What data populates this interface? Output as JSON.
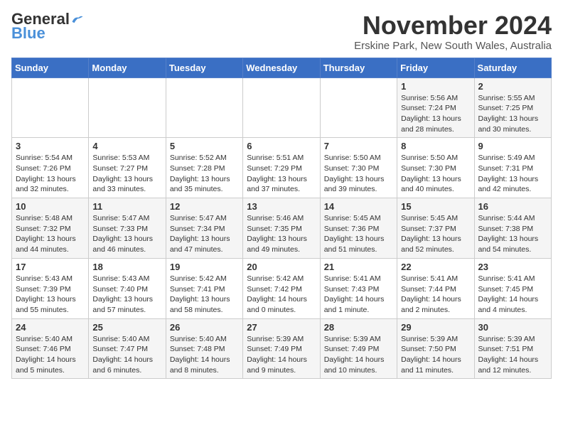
{
  "header": {
    "logo_general": "General",
    "logo_blue": "Blue",
    "title": "November 2024",
    "location": "Erskine Park, New South Wales, Australia"
  },
  "weekdays": [
    "Sunday",
    "Monday",
    "Tuesday",
    "Wednesday",
    "Thursday",
    "Friday",
    "Saturday"
  ],
  "weeks": [
    [
      {
        "day": "",
        "info": ""
      },
      {
        "day": "",
        "info": ""
      },
      {
        "day": "",
        "info": ""
      },
      {
        "day": "",
        "info": ""
      },
      {
        "day": "",
        "info": ""
      },
      {
        "day": "1",
        "info": "Sunrise: 5:56 AM\nSunset: 7:24 PM\nDaylight: 13 hours\nand 28 minutes."
      },
      {
        "day": "2",
        "info": "Sunrise: 5:55 AM\nSunset: 7:25 PM\nDaylight: 13 hours\nand 30 minutes."
      }
    ],
    [
      {
        "day": "3",
        "info": "Sunrise: 5:54 AM\nSunset: 7:26 PM\nDaylight: 13 hours\nand 32 minutes."
      },
      {
        "day": "4",
        "info": "Sunrise: 5:53 AM\nSunset: 7:27 PM\nDaylight: 13 hours\nand 33 minutes."
      },
      {
        "day": "5",
        "info": "Sunrise: 5:52 AM\nSunset: 7:28 PM\nDaylight: 13 hours\nand 35 minutes."
      },
      {
        "day": "6",
        "info": "Sunrise: 5:51 AM\nSunset: 7:29 PM\nDaylight: 13 hours\nand 37 minutes."
      },
      {
        "day": "7",
        "info": "Sunrise: 5:50 AM\nSunset: 7:30 PM\nDaylight: 13 hours\nand 39 minutes."
      },
      {
        "day": "8",
        "info": "Sunrise: 5:50 AM\nSunset: 7:30 PM\nDaylight: 13 hours\nand 40 minutes."
      },
      {
        "day": "9",
        "info": "Sunrise: 5:49 AM\nSunset: 7:31 PM\nDaylight: 13 hours\nand 42 minutes."
      }
    ],
    [
      {
        "day": "10",
        "info": "Sunrise: 5:48 AM\nSunset: 7:32 PM\nDaylight: 13 hours\nand 44 minutes."
      },
      {
        "day": "11",
        "info": "Sunrise: 5:47 AM\nSunset: 7:33 PM\nDaylight: 13 hours\nand 46 minutes."
      },
      {
        "day": "12",
        "info": "Sunrise: 5:47 AM\nSunset: 7:34 PM\nDaylight: 13 hours\nand 47 minutes."
      },
      {
        "day": "13",
        "info": "Sunrise: 5:46 AM\nSunset: 7:35 PM\nDaylight: 13 hours\nand 49 minutes."
      },
      {
        "day": "14",
        "info": "Sunrise: 5:45 AM\nSunset: 7:36 PM\nDaylight: 13 hours\nand 51 minutes."
      },
      {
        "day": "15",
        "info": "Sunrise: 5:45 AM\nSunset: 7:37 PM\nDaylight: 13 hours\nand 52 minutes."
      },
      {
        "day": "16",
        "info": "Sunrise: 5:44 AM\nSunset: 7:38 PM\nDaylight: 13 hours\nand 54 minutes."
      }
    ],
    [
      {
        "day": "17",
        "info": "Sunrise: 5:43 AM\nSunset: 7:39 PM\nDaylight: 13 hours\nand 55 minutes."
      },
      {
        "day": "18",
        "info": "Sunrise: 5:43 AM\nSunset: 7:40 PM\nDaylight: 13 hours\nand 57 minutes."
      },
      {
        "day": "19",
        "info": "Sunrise: 5:42 AM\nSunset: 7:41 PM\nDaylight: 13 hours\nand 58 minutes."
      },
      {
        "day": "20",
        "info": "Sunrise: 5:42 AM\nSunset: 7:42 PM\nDaylight: 14 hours\nand 0 minutes."
      },
      {
        "day": "21",
        "info": "Sunrise: 5:41 AM\nSunset: 7:43 PM\nDaylight: 14 hours\nand 1 minute."
      },
      {
        "day": "22",
        "info": "Sunrise: 5:41 AM\nSunset: 7:44 PM\nDaylight: 14 hours\nand 2 minutes."
      },
      {
        "day": "23",
        "info": "Sunrise: 5:41 AM\nSunset: 7:45 PM\nDaylight: 14 hours\nand 4 minutes."
      }
    ],
    [
      {
        "day": "24",
        "info": "Sunrise: 5:40 AM\nSunset: 7:46 PM\nDaylight: 14 hours\nand 5 minutes."
      },
      {
        "day": "25",
        "info": "Sunrise: 5:40 AM\nSunset: 7:47 PM\nDaylight: 14 hours\nand 6 minutes."
      },
      {
        "day": "26",
        "info": "Sunrise: 5:40 AM\nSunset: 7:48 PM\nDaylight: 14 hours\nand 8 minutes."
      },
      {
        "day": "27",
        "info": "Sunrise: 5:39 AM\nSunset: 7:49 PM\nDaylight: 14 hours\nand 9 minutes."
      },
      {
        "day": "28",
        "info": "Sunrise: 5:39 AM\nSunset: 7:49 PM\nDaylight: 14 hours\nand 10 minutes."
      },
      {
        "day": "29",
        "info": "Sunrise: 5:39 AM\nSunset: 7:50 PM\nDaylight: 14 hours\nand 11 minutes."
      },
      {
        "day": "30",
        "info": "Sunrise: 5:39 AM\nSunset: 7:51 PM\nDaylight: 14 hours\nand 12 minutes."
      }
    ]
  ]
}
